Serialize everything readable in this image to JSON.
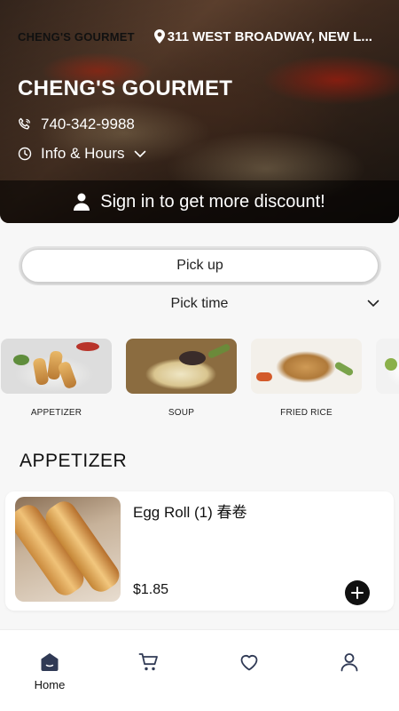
{
  "hero": {
    "brand_small": "CHENG'S GOURMET",
    "address": "311 WEST BROADWAY, NEW L...",
    "title": "CHENG'S GOURMET",
    "phone": "740-342-9988",
    "info_hours": "Info & Hours",
    "signin": "Sign in to get more discount!"
  },
  "order": {
    "pickup_label": "Pick up",
    "picktime_label": "Pick time"
  },
  "categories": [
    {
      "label": "APPETIZER"
    },
    {
      "label": "SOUP"
    },
    {
      "label": "FRIED RICE"
    }
  ],
  "section": {
    "title": "APPETIZER",
    "items": [
      {
        "name": "Egg Roll (1) 春卷",
        "price": "$1.85"
      }
    ]
  },
  "tabbar": {
    "home_label": "Home"
  },
  "icons": {
    "pin": "map-pin-icon",
    "phone": "phone-icon",
    "clock": "clock-icon",
    "chevron": "chevron-down-icon",
    "user": "user-icon",
    "plus": "plus-icon",
    "home": "home-icon",
    "cart": "cart-icon",
    "heart": "heart-icon",
    "profile": "profile-icon"
  }
}
